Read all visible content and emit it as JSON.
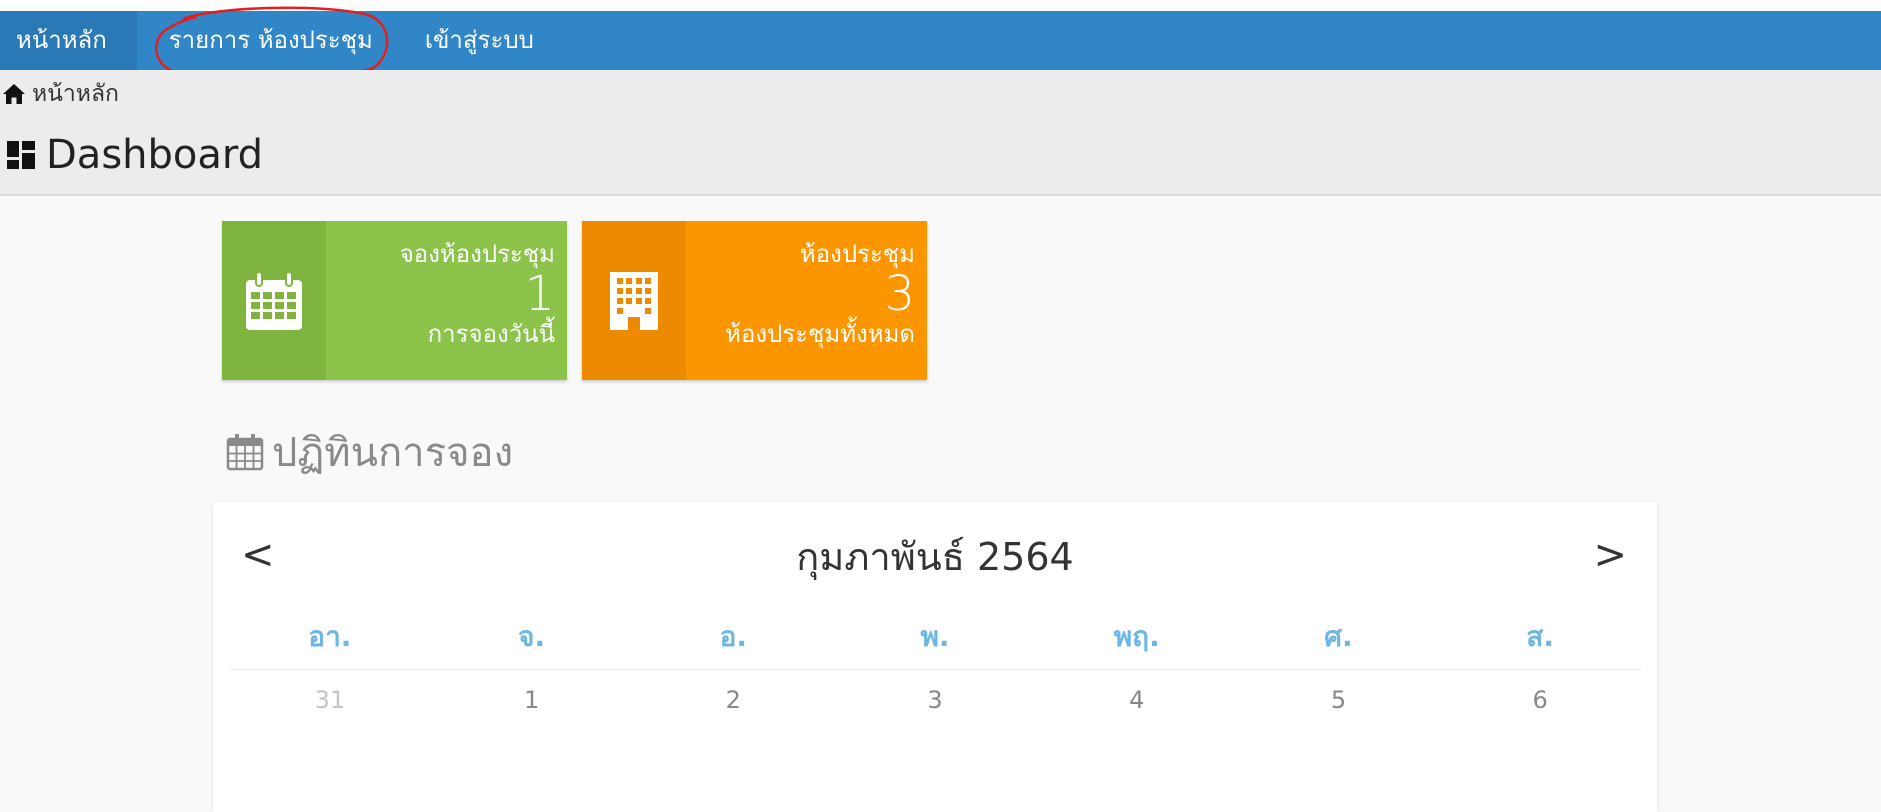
{
  "nav": {
    "home": "หน้าหลัก",
    "rooms": "รายการ ห้องประชุม",
    "login": "เข้าสู่ระบบ"
  },
  "breadcrumb": {
    "label": "หน้าหลัก"
  },
  "page_title": "Dashboard",
  "cards": [
    {
      "title": "จองห้องประชุม",
      "value": "1",
      "caption": "การจองวันนี้",
      "icon": "calendar-icon"
    },
    {
      "title": "ห้องประชุม",
      "value": "3",
      "caption": "ห้องประชุมทั้งหมด",
      "icon": "building-icon"
    }
  ],
  "section_title": "ปฏิทินการจอง",
  "calendar": {
    "prev": "<",
    "next": ">",
    "month": "กุมภาพันธ์ 2564",
    "weekdays": [
      "อา.",
      "จ.",
      "อ.",
      "พ.",
      "พฤ.",
      "ศ.",
      "ส."
    ],
    "days": [
      "31",
      "1",
      "2",
      "3",
      "4",
      "5",
      "6"
    ]
  },
  "colors": {
    "navbar": "#3186c7",
    "card_green": "#8cc34a",
    "card_orange": "#fb9600",
    "weekday_text": "#6eb6e3",
    "annotation": "#e02020"
  }
}
